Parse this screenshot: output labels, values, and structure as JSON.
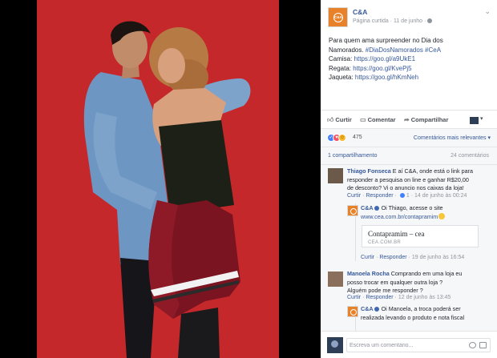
{
  "post": {
    "page_name": "C&A",
    "logo_text": "C&A",
    "meta": "Página curtida · 11 de junho ·",
    "text_line1": "Para quem ama surpreender no Dia dos",
    "text_line2_plain": "Namorados. ",
    "hashtags": "#DiaDosNamorados #CeA",
    "links": [
      {
        "label": "Camisa: ",
        "url": "https://goo.gl/a9UkE1"
      },
      {
        "label": "Regata: ",
        "url": "https://goo.gl/KvePj5"
      },
      {
        "label": "Jaqueta: ",
        "url": "https://goo.gl/hKmNeh"
      }
    ]
  },
  "actions": {
    "like": "Curtir",
    "comment": "Comentar",
    "share": "Compartilhar",
    "like_icon": "thumbs-up-icon",
    "comment_icon": "speech-bubble-icon",
    "share_icon": "share-arrow-icon"
  },
  "reactions": {
    "count": "475",
    "sort_label": "Comentários mais relevantes ▾",
    "types": [
      "like",
      "love",
      "haha"
    ],
    "colors": {
      "like": "#4080ff",
      "love": "#f25268",
      "haha": "#f7b928"
    }
  },
  "stats": {
    "shares": "1 compartilhamento",
    "comments": "24 comentários"
  },
  "comments": [
    {
      "author": "Thiago Fonseca",
      "text_first": "E aí C&A, onde está o link para",
      "text_lines": [
        "responder a pesquisa on line e ganhar R$20,00",
        "de desconto? Vi o anuncio nos caixas da loja!"
      ],
      "like": "Curtir",
      "reply": "Responder",
      "likes": "1",
      "time": "14 de junho às 00:24",
      "reply_comment": {
        "author": "C&A",
        "text": "Oi Thiago, acesse o site",
        "link": "www.cea.com.br/contapramim",
        "card_title": "Contapramim – cea",
        "card_domain": "CEA.COM.BR",
        "like": "Curtir",
        "reply": "Responder",
        "time": "19 de junho às 16:54"
      }
    },
    {
      "author": "Manoela Rocha",
      "text_first": "Comprando em uma loja eu",
      "text_lines": [
        "posso trocar em qualquer outra loja ?",
        "Alguém pode me responder ?"
      ],
      "like": "Curtir",
      "reply": "Responder",
      "time": "12 de junho às 13:45",
      "reply_comment": {
        "author": "C&A",
        "text": "Oi Manoela, a troca poderá ser",
        "text_lines": [
          "realizada levando o produto e nota fiscal"
        ]
      }
    }
  ],
  "composer": {
    "placeholder": "Escreva um comentário..."
  },
  "colors": {
    "brand_orange": "#e8822a",
    "link_blue": "#365899",
    "photo_background": "#c4282a"
  }
}
